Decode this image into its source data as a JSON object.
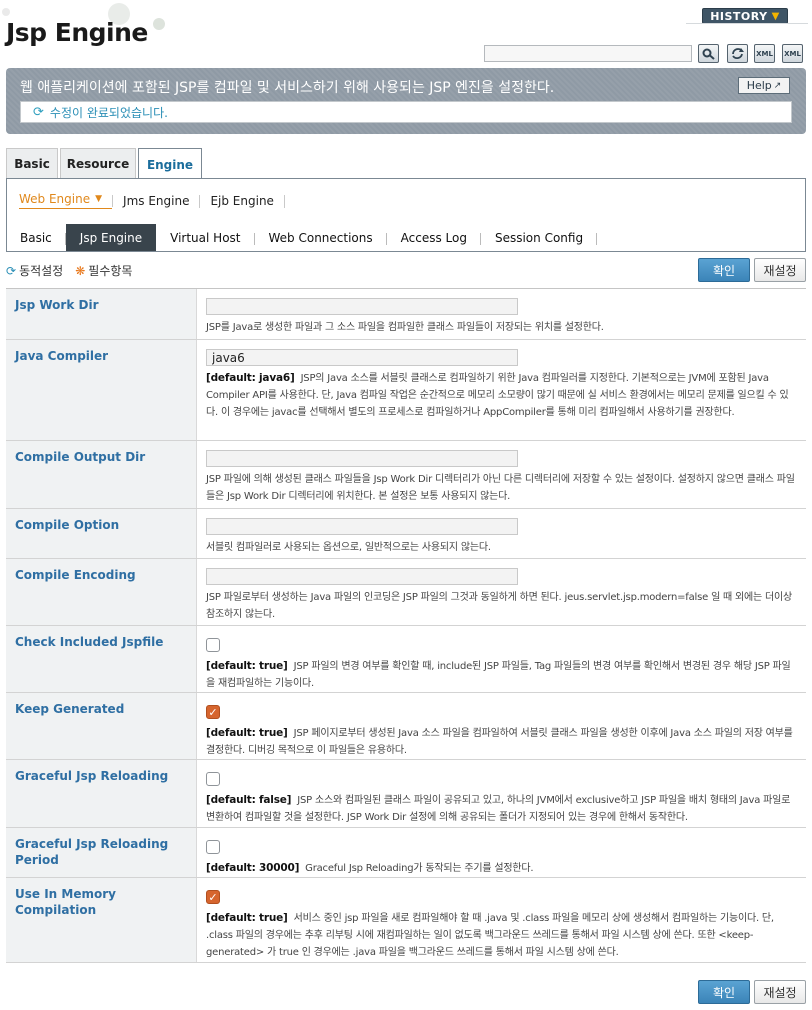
{
  "header": {
    "title": "Jsp Engine",
    "history_label": "HISTORY"
  },
  "toolbar": {
    "search_value": "",
    "icons": [
      "search-icon",
      "refresh-icon",
      "xml-export-icon",
      "xml-import-icon"
    ],
    "xml_label": "XML"
  },
  "banner": {
    "description": "웹 애플리케이션에 포함된 JSP를 컴파일 및 서비스하기 위해 사용되는 JSP 엔진을 설정한다.",
    "help_label": "Help",
    "status_message": "수정이 완료되었습니다."
  },
  "tabs": {
    "top": [
      {
        "label": "Basic"
      },
      {
        "label": "Resource"
      },
      {
        "label": "Engine",
        "active": true
      }
    ],
    "engines": [
      {
        "label": "Web Engine",
        "active": true
      },
      {
        "label": "Jms Engine"
      },
      {
        "label": "Ejb Engine"
      }
    ],
    "web": [
      {
        "label": "Basic"
      },
      {
        "label": "Jsp Engine",
        "active": true
      },
      {
        "label": "Virtual Host"
      },
      {
        "label": "Web Connections"
      },
      {
        "label": "Access Log"
      },
      {
        "label": "Session Config"
      }
    ]
  },
  "legend": {
    "dynamic": "동적설정",
    "required": "필수항목"
  },
  "buttons": {
    "confirm": "확인",
    "reset": "재설정"
  },
  "colors": {
    "label_text": "#2f6fa3",
    "accent_orange": "#e0881c",
    "checkbox_checked": "#d6652e",
    "banner_bg": "#8f9aa5"
  },
  "fields": [
    {
      "label": "Jsp Work Dir",
      "type": "text",
      "value": "",
      "default": "",
      "description": "JSP를 Java로 생성한 파일과 그 소스 파일을 컴파일한 클래스 파일들이 저장되는 위치를 설정한다."
    },
    {
      "label": "Java Compiler",
      "type": "text",
      "value": "java6",
      "default": "[default: java6]",
      "description": "JSP의 Java 소스를 서블릿 클래스로 컴파일하기 위한 Java 컴파일러를 지정한다. 기본적으로는 JVM에 포함된 Java Compiler API를 사용한다. 단, Java 컴파일 작업은 순간적으로 메모리 소모량이 많기 때문에 실 서비스 환경에서는 메모리 문제를 일으킬 수 있다. 이 경우에는 javac를 선택해서 별도의 프로세스로 컴파일하거나 AppCompiler를 통해 미리 컴파일해서 사용하기를 권장한다."
    },
    {
      "label": "Compile Output Dir",
      "type": "text",
      "value": "",
      "default": "",
      "description": "JSP 파일에 의해 생성된 클래스 파일들을 Jsp Work Dir 디렉터리가 아닌 다른 디렉터리에 저장할 수 있는 설정이다. 설정하지 않으면 클래스 파일들은 Jsp Work Dir 디렉터리에 위치한다. 본 설정은 보통 사용되지 않는다."
    },
    {
      "label": "Compile Option",
      "type": "text",
      "value": "",
      "default": "",
      "description": "서블릿 컴파일러로 사용되는 옵션으로, 일반적으로는 사용되지 않는다."
    },
    {
      "label": "Compile Encoding",
      "type": "text",
      "value": "",
      "default": "",
      "description": "JSP 파일로부터 생성하는 Java 파일의 인코딩은 JSP 파일의 그것과 동일하게 하면 된다. jeus.servlet.jsp.modern=false 일 때 외에는 더이상 참조하지 않는다."
    },
    {
      "label": "Check Included Jspfile",
      "type": "checkbox",
      "checked": false,
      "default": "[default: true]",
      "description": "JSP 파일의 변경 여부를 확인할 때, include된 JSP 파일들, Tag 파일들의 변경 여부를 확인해서 변경된 경우 해당 JSP 파일을 재컴파일하는 기능이다."
    },
    {
      "label": "Keep Generated",
      "type": "checkbox",
      "checked": true,
      "default": "[default: true]",
      "description": "JSP 페이지로부터 생성된 Java 소스 파일을 컴파일하여 서블릿 클래스 파일을 생성한 이후에 Java 소스 파일의 저장 여부를 결정한다. 디버깅 목적으로 이 파일들은 유용하다."
    },
    {
      "label": "Graceful Jsp Reloading",
      "type": "checkbox",
      "checked": false,
      "default": "[default: false]",
      "description": "JSP 소스와 컴파일된 클래스 파일이 공유되고 있고, 하나의 JVM에서 exclusive하고 JSP 파일을 배치 형태의 Java 파일로 변환하여 컴파일할 것을 설정한다. JSP Work Dir 설정에 의해 공유되는 폴더가 지정되어 있는 경우에 한해서 동작한다."
    },
    {
      "label": "Graceful Jsp Reloading Period",
      "type": "checkbox",
      "checked": false,
      "default": "[default: 30000]",
      "description": "Graceful Jsp Reloading가 동작되는 주기를 설정한다."
    },
    {
      "label": "Use In Memory Compilation",
      "type": "checkbox",
      "checked": true,
      "default": "[default: true]",
      "description": "서비스 중인 jsp 파일을 새로 컴파일해야 할 때 .java 및 .class 파일을 메모리 상에 생성해서 컴파일하는 기능이다. 단, .class 파일의 경우에는 추후 리부팅 시에 재컴파일하는 일이 없도록 백그라운드 쓰레드를 통해서 파일 시스템 상에 쓴다. 또한 <keep-generated> 가 true 인 경우에는 .java 파일을 백그라운드 쓰레드를 통해서 파일 시스템 상에 쓴다."
    }
  ]
}
